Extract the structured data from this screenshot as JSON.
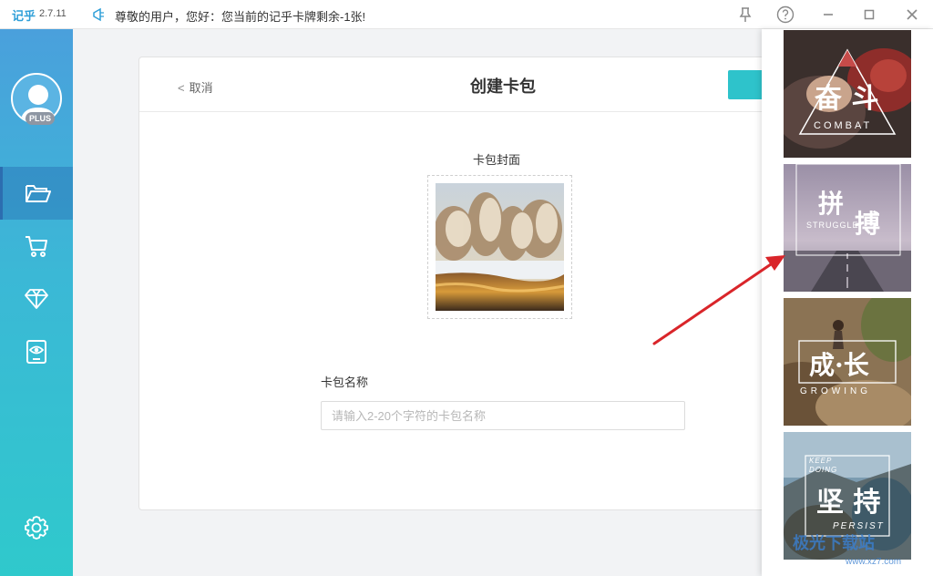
{
  "titlebar": {
    "app_name": "记乎",
    "version": "2.7.11",
    "notice": "尊敬的用户，您好：您当前的记乎卡牌剩余-1张!"
  },
  "sidebar": {
    "plus_badge": "PLUS",
    "items": [
      {
        "icon": "folder-icon",
        "active": true
      },
      {
        "icon": "cart-icon",
        "active": false
      },
      {
        "icon": "diamond-icon",
        "active": false
      },
      {
        "icon": "eye-card-icon",
        "active": false
      },
      {
        "icon": "settings-icon",
        "active": false
      }
    ]
  },
  "card": {
    "cancel_label": "取消",
    "title": "创建卡包",
    "cover_label": "卡包封面",
    "name_label": "卡包名称",
    "name_placeholder": "请输入2-20个字符的卡包名称",
    "name_value": ""
  },
  "templates": [
    {
      "title": "奋 斗",
      "subtitle": "COMBAT"
    },
    {
      "title_a": "拼",
      "title_b": "搏",
      "subtitle": "STRUGGLE"
    },
    {
      "title": "成·长",
      "subtitle": "GROWING"
    },
    {
      "title": "坚 持",
      "top_text": "KEEP DOING",
      "subtitle": "PERSIST"
    }
  ],
  "watermark": {
    "text": "极光下载站",
    "url_text": "www.xz7.com"
  },
  "colors": {
    "accent": "#2ec3cb",
    "sidebar_top": "#4aa0dc",
    "sidebar_bottom": "#2fc9cc",
    "arrow": "#d9252a"
  }
}
